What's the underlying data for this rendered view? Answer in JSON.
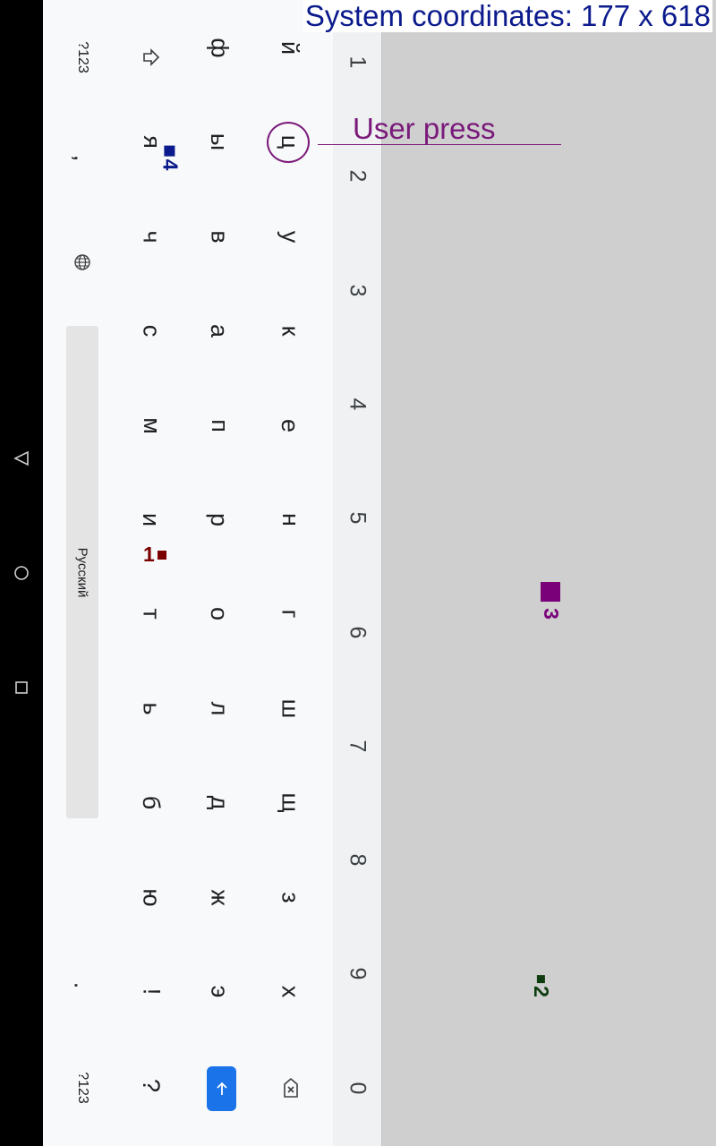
{
  "overlay": {
    "system_coordinates": "System coordinates: 177 x 618",
    "user_press": "User press"
  },
  "markers": [
    {
      "label": "1",
      "color": "#7a0000"
    },
    {
      "label": "2",
      "color": "#0f3d0f"
    },
    {
      "label": "3",
      "color": "#7a007a"
    },
    {
      "label": "4",
      "color": "#0b1a8c"
    }
  ],
  "keyboard": {
    "number_row": [
      "1",
      "2",
      "3",
      "4",
      "5",
      "6",
      "7",
      "8",
      "9",
      "0"
    ],
    "row1": [
      "й",
      "ц",
      "у",
      "к",
      "е",
      "н",
      "г",
      "ш",
      "щ",
      "з",
      "х"
    ],
    "row2": [
      "ф",
      "ы",
      "в",
      "а",
      "п",
      "р",
      "о",
      "л",
      "д",
      "ж",
      "э"
    ],
    "row3": [
      "я",
      "ч",
      "с",
      "м",
      "и",
      "т",
      "ь",
      "б",
      "ю",
      "!",
      "?"
    ],
    "bottom": {
      "symbols_left": "?123",
      "comma": ",",
      "space_label": "Русский",
      "period": ".",
      "symbols_right": "?123"
    }
  },
  "icons": {
    "shift": "shift-icon",
    "globe": "globe-icon",
    "backspace": "backspace-icon",
    "enter": "enter-icon",
    "back": "nav-back-icon",
    "home": "nav-home-icon",
    "recents": "nav-recents-icon"
  },
  "colors": {
    "accent": "#1a73e8",
    "annotation": "#7a1a7a"
  }
}
